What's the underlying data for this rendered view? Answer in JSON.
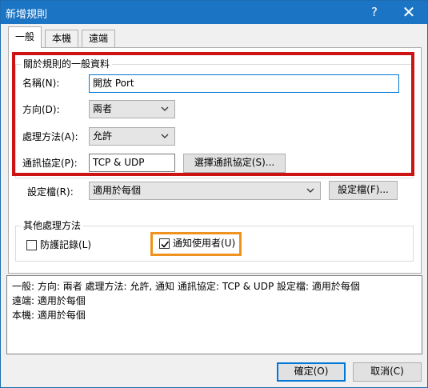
{
  "window": {
    "title": "新增規則",
    "help_glyph": "?",
    "close_glyph": "✕"
  },
  "tabs": [
    {
      "label": "一般",
      "active": true
    },
    {
      "label": "本機",
      "active": false
    },
    {
      "label": "遠端",
      "active": false
    }
  ],
  "general_group": {
    "title": "關於規則的一般資料",
    "name_label": "名稱(N):",
    "name_value": "開放 Port",
    "direction_label": "方向(D):",
    "direction_value": "兩者",
    "action_label": "處理方法(A):",
    "action_value": "允許",
    "protocol_label": "通訊協定(P):",
    "protocol_value": "TCP & UDP",
    "protocol_button": "選擇通訊協定(S)..."
  },
  "profile": {
    "label": "設定檔(R):",
    "value": "適用於每個",
    "button": "設定檔(F)..."
  },
  "other_group": {
    "title": "其他處理方法",
    "log_label": "防護記錄(L)",
    "log_checked": false,
    "notify_label": "通知使用者(U)",
    "notify_checked": true
  },
  "summary": {
    "line1": "一般:  方向: 兩者   處理方法: 允許, 通知   通訊協定: TCP & UDP   設定檔: 適用於每個",
    "line2": "遠端:  適用於每個",
    "line3": "本機:  適用於每個"
  },
  "footer": {
    "ok": "確定(O)",
    "cancel": "取消(C)"
  },
  "colors": {
    "titlebar": "#1c74c4",
    "highlight_red": "#cc1414",
    "highlight_orange": "#f0921e",
    "focus_blue": "#0078d7"
  }
}
